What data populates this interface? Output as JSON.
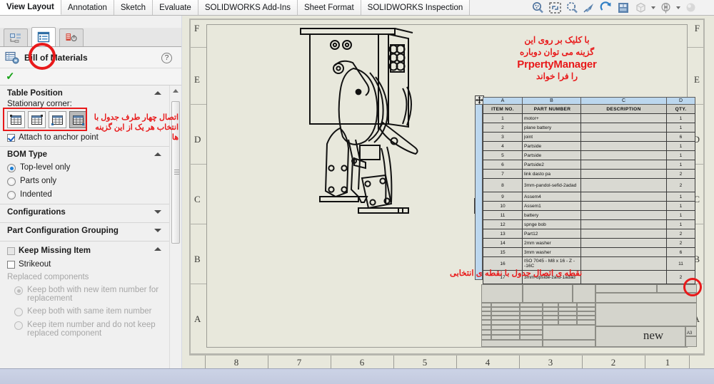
{
  "ribbon": {
    "tabs": [
      {
        "label": "View Layout",
        "active": true
      },
      {
        "label": "Annotation",
        "active": false
      },
      {
        "label": "Sketch",
        "active": false
      },
      {
        "label": "Evaluate",
        "active": false
      },
      {
        "label": "SOLIDWORKS Add-Ins",
        "active": false
      },
      {
        "label": "Sheet Format",
        "active": false
      },
      {
        "label": "SOLIDWORKS Inspection",
        "active": false
      }
    ],
    "toolbar_icons": [
      "zoom-to-area-icon",
      "zoom-to-fit-icon",
      "zoom-in-out-icon",
      "pan-icon",
      "rotate-view-icon",
      "view-orientation-icon",
      "display-style-icon",
      "hide-show-items-icon",
      "apply-scene-icon"
    ]
  },
  "property_manager": {
    "red_label": "PropertyManager",
    "tabs": [
      {
        "name": "feature-manager-design-tree",
        "active": false
      },
      {
        "name": "property-manager",
        "active": true
      },
      {
        "name": "configuration-manager",
        "active": false
      }
    ],
    "title": "Bill of Materials",
    "help_glyph": "?",
    "ok_glyph": "✓",
    "sections": {
      "table_position": {
        "title": "Table Position",
        "stationary_corner_label": "Stationary corner:",
        "corner_buttons": [
          {
            "name": "corner-top-left",
            "selected": false
          },
          {
            "name": "corner-top-right",
            "selected": false
          },
          {
            "name": "corner-bottom-left",
            "selected": false
          },
          {
            "name": "corner-bottom-right",
            "selected": true
          }
        ],
        "attach_anchor": {
          "label": "Attach to anchor point",
          "checked": true
        }
      },
      "bom_type": {
        "title": "BOM Type",
        "options": [
          {
            "label": "Top-level only",
            "selected": true
          },
          {
            "label": "Parts only",
            "selected": false
          },
          {
            "label": "Indented",
            "selected": false
          }
        ]
      },
      "configurations": {
        "title": "Configurations",
        "collapsed": true
      },
      "part_configuration_grouping": {
        "title": "Part Configuration Grouping",
        "collapsed": true
      },
      "keep_missing_item": {
        "title": "Keep Missing Item",
        "checked": false,
        "strikeout": {
          "label": "Strikeout",
          "checked": false
        },
        "replaced_components_label": "Replaced components",
        "options": [
          {
            "label": "Keep both with new item number for replacement",
            "selected": true,
            "disabled": true
          },
          {
            "label": "Keep both with same item number",
            "selected": false,
            "disabled": true
          },
          {
            "label": "Keep item number and do not keep replaced component",
            "selected": false,
            "disabled": true
          }
        ]
      }
    }
  },
  "annotations": {
    "panel_note": "اتصال چهار طرف جدول با انتخاب هر یک از این گزینه ها",
    "canvas_note_line1": "با کلیک بر روی این",
    "canvas_note_line2": "گزینه می توان دوباره",
    "canvas_note_latin": "PrpertyManager",
    "canvas_note_line3": "را فرا خواند",
    "canvas_note_bottom": "نقطه ی اتصال جدول با نقطه ی انتخابی",
    "highlight_color": "#e8191a"
  },
  "drawing_sheet": {
    "zone_rows": [
      "F",
      "E",
      "D",
      "C",
      "B",
      "A"
    ],
    "zone_cols": [
      "8",
      "7",
      "6",
      "5",
      "4",
      "3",
      "2",
      "1"
    ],
    "title_block": {
      "drawing_name": "new",
      "sheet_size": "A3"
    }
  },
  "bom_table": {
    "column_letters": [
      "A",
      "B",
      "C",
      "D"
    ],
    "headers": [
      "ITEM NO.",
      "PART NUMBER",
      "DESCRIPTION",
      "QTY."
    ],
    "rows": [
      {
        "item": "1",
        "part": "motor+",
        "desc": "",
        "qty": "1"
      },
      {
        "item": "2",
        "part": "plane battery",
        "desc": "",
        "qty": "1"
      },
      {
        "item": "3",
        "part": "joint",
        "desc": "",
        "qty": "6"
      },
      {
        "item": "4",
        "part": "Partside",
        "desc": "",
        "qty": "1"
      },
      {
        "item": "5",
        "part": "Partside",
        "desc": "",
        "qty": "1"
      },
      {
        "item": "6",
        "part": "Partside2",
        "desc": "",
        "qty": "1"
      },
      {
        "item": "7",
        "part": "link dasto pa",
        "desc": "",
        "qty": "2"
      },
      {
        "item": "8",
        "part": "3mm-pandol-sefid-2adad",
        "desc": "",
        "qty": "2",
        "tall": true
      },
      {
        "item": "9",
        "part": "Assem4",
        "desc": "",
        "qty": "1"
      },
      {
        "item": "10",
        "part": "Assem1",
        "desc": "",
        "qty": "1"
      },
      {
        "item": "11",
        "part": "battery",
        "desc": "",
        "qty": "1"
      },
      {
        "item": "12",
        "part": "spnge bob",
        "desc": "",
        "qty": "1"
      },
      {
        "item": "13",
        "part": "Part12",
        "desc": "",
        "qty": "2"
      },
      {
        "item": "14",
        "part": "2mm washer",
        "desc": "",
        "qty": "2"
      },
      {
        "item": "15",
        "part": "3mm washer",
        "desc": "",
        "qty": "6"
      },
      {
        "item": "16",
        "part": "ISO 7045 - M8 x 16 - Z - -16C",
        "desc": "",
        "qty": "11",
        "tall": true
      },
      {
        "item": "17",
        "part": "3mm-upside-zard-1adad",
        "desc": "",
        "qty": "2",
        "tall": true
      }
    ]
  }
}
